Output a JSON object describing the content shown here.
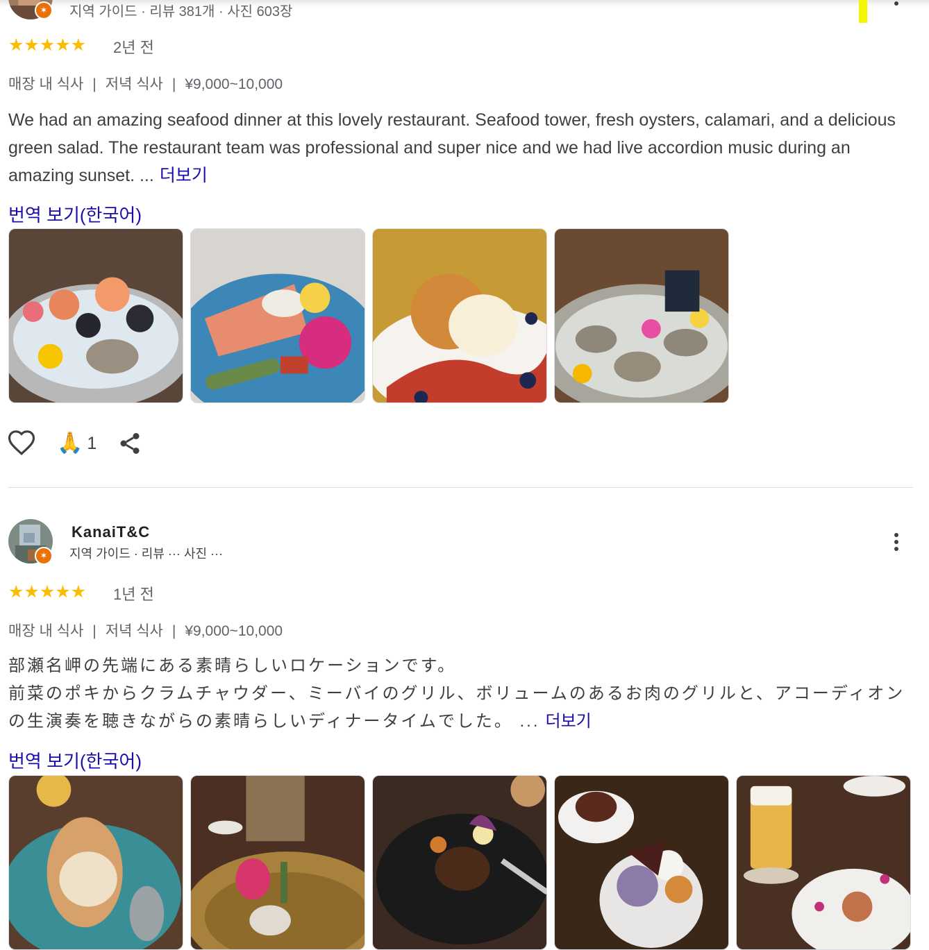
{
  "reviews": [
    {
      "meta": "지역 가이드 · 리뷰 381개 · 사진 603장",
      "stars": "★★★★★",
      "when": "2년 전",
      "tags": [
        "매장 내 식사",
        "저녁 식사",
        "¥9,000~10,000"
      ],
      "text": "We had an amazing seafood dinner at this lovely restaurant. Seafood tower, fresh oysters, calamari, and a delicious green salad. The restaurant team was professional and super nice and we had live accordion music during an amazing sunset. ...",
      "more": "더보기",
      "translate": "번역 보기(한국어)",
      "reaction_count": "1"
    },
    {
      "name": "KanaiT&C",
      "meta": "지역 가이드 · 리뷰 ··· 사진 ···",
      "stars": "★★★★★",
      "when": "1년 전",
      "tags": [
        "매장 내 식사",
        "저녁 식사",
        "¥9,000~10,000"
      ],
      "text_line1": "部瀬名岬の先端にある素晴らしいロケーションです。",
      "text_line2": "前菜のポキからクラムチャウダー、ミーバイのグリル、ボリュームのあるお肉のグリルと、アコーディオンの生演奏を聴きながらの素晴らしいディナータイムでした。 ...",
      "more": "더보기",
      "translate": "번역 보기(한국어)"
    }
  ],
  "colors": {
    "star": "#fbbc04",
    "link": "#1a0dab",
    "badge": "#e8710a"
  },
  "icons": [
    "heart-icon",
    "praying-hands-emoji",
    "share-icon",
    "more-vert-icon"
  ]
}
